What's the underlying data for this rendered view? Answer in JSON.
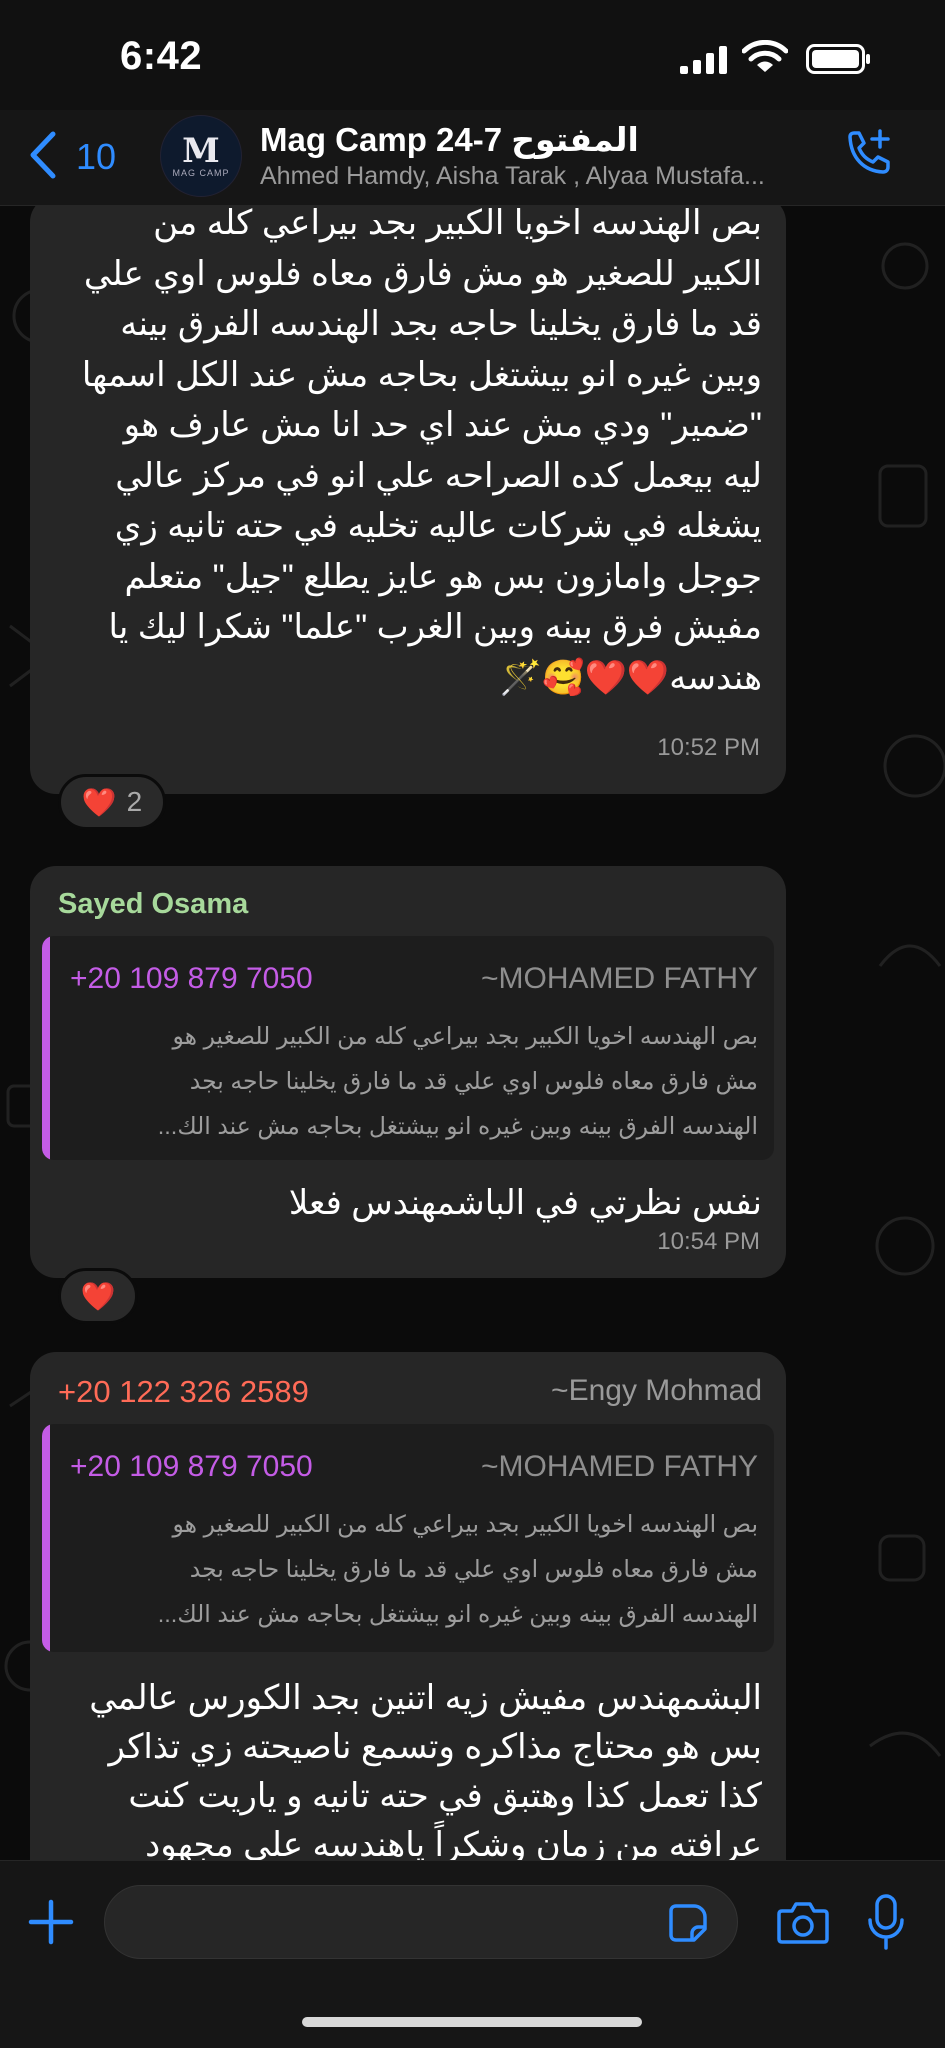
{
  "status_bar": {
    "time": "6:42"
  },
  "header": {
    "back_count": "10",
    "avatar_letter": "M",
    "avatar_caption": "MAG CAMP",
    "title": "Mag Camp 24-7 المفتوح",
    "members": "Ahmed Hamdy, Aisha Tarak , Alyaa Mustafa..."
  },
  "messages": [
    {
      "lines": [
        "بص الهندسه اخويا الكبير بجد بيراعي كله من",
        "الكبير للصغير هو مش فارق معاه فلوس اوي علي",
        "قد ما فارق يخلينا حاجه بجد الهندسه الفرق بينه",
        "وبين غيره انو بيشتغل بحاجه مش عند الكل اسمها",
        "\"ضمير\" ودي مش عند اي حد انا مش عارف هو",
        "ليه بيعمل كده الصراحه  علي انو في مركز عالي",
        "يشغله في شركات عاليه تخليه في حته تانيه زي",
        "جوجل وامازون بس هو عايز يطلع \"جيل\" متعلم",
        "مفيش فرق بينه وبين الغرب \"علما\" شكرا ليك يا",
        "هندسه❤️❤️🥰🪄"
      ],
      "time": "10:52 PM",
      "reaction": {
        "emoji": "❤️",
        "count": "2"
      }
    },
    {
      "sender": "Sayed Osama",
      "quote": {
        "phone": "+20 109 879 7050",
        "author": "~MOHAMED FATHY",
        "lines": [
          "بص الهندسه اخويا الكبير بجد بيراعي كله من الكبير للصغير هو",
          "مش فارق معاه فلوس اوي علي قد ما فارق يخلينا حاجه بجد",
          "الهندسه الفرق بينه وبين غيره انو بيشتغل بحاجه مش عند الك..."
        ]
      },
      "text": "نفس نظرتي في الباشمهندس فعلا",
      "time": "10:54 PM",
      "reaction": {
        "emoji": "❤️"
      }
    },
    {
      "sender_phone": "+20 122 326 2589",
      "sender_name": "~Engy Mohmad",
      "quote": {
        "phone": "+20 109 879 7050",
        "author": "~MOHAMED FATHY",
        "lines": [
          "بص الهندسه اخويا الكبير بجد بيراعي كله من الكبير للصغير هو",
          "مش فارق معاه فلوس اوي علي قد ما فارق يخلينا حاجه بجد",
          "الهندسه الفرق بينه وبين غيره انو بيشتغل بحاجه مش عند الك..."
        ]
      },
      "lines": [
        "البشمهندس مفيش زيه اتنين بجد الكورس عالمي",
        "بس هو محتاج مذاكره وتسمع ناصيحته زي تذاكر",
        "كذا تعمل كذا وهتبق في حته تانيه و ياريت كنت",
        "عرافته من زمان وشكراً ياهندسه على مجهود"
      ]
    }
  ],
  "colors": {
    "accent_blue": "#2f8cff",
    "sender_green": "#a7d99b",
    "sender_red": "#ff6b57",
    "quote_purple": "#c45ce6",
    "bubble": "#262626"
  },
  "icons": [
    "signal-icon",
    "wifi-icon",
    "battery-icon",
    "back-chevron-icon",
    "add-call-icon",
    "plus-icon",
    "sticker-icon",
    "camera-icon",
    "microphone-icon"
  ]
}
